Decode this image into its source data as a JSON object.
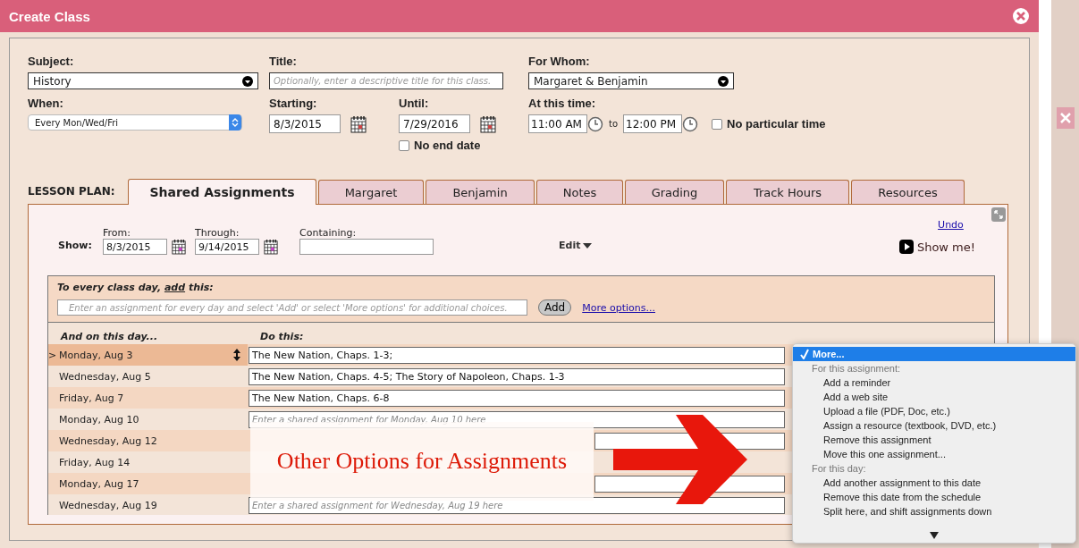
{
  "window": {
    "title": "Create Class"
  },
  "form": {
    "subject": {
      "label": "Subject:",
      "value": "History"
    },
    "title": {
      "label": "Title:",
      "placeholder": "Optionally, enter a descriptive title for this class."
    },
    "for_whom": {
      "label": "For Whom:",
      "value": "Margaret & Benjamin"
    },
    "when": {
      "label": "When:",
      "value": "Every Mon/Wed/Fri"
    },
    "starting": {
      "label": "Starting:",
      "value": "8/3/2015"
    },
    "until": {
      "label": "Until:",
      "value": "7/29/2016"
    },
    "no_end_date": {
      "label": "No end date",
      "checked": false
    },
    "at_this_time": {
      "label": "At this time:",
      "start": "11:00 AM",
      "to": "to",
      "end": "12:00 PM"
    },
    "no_particular_time": {
      "label": "No particular time",
      "checked": false
    }
  },
  "lesson_plan": {
    "label": "LESSON PLAN:",
    "tabs": [
      {
        "label": "Shared Assignments",
        "selected": true
      },
      {
        "label": "Margaret",
        "selected": false
      },
      {
        "label": "Benjamin",
        "selected": false
      },
      {
        "label": "Notes",
        "selected": false
      },
      {
        "label": "Grading",
        "selected": false
      },
      {
        "label": "Track Hours",
        "selected": false
      },
      {
        "label": "Resources",
        "selected": false
      }
    ]
  },
  "filter": {
    "show": "Show:",
    "from": {
      "label": "From:",
      "value": "8/3/2015"
    },
    "through": {
      "label": "Through:",
      "value": "9/14/2015"
    },
    "containing": {
      "label": "Containing:"
    },
    "edit": "Edit",
    "undo": "Undo",
    "show_me": "Show me!"
  },
  "every_day": {
    "heading_start": "To every class day,",
    "heading_link": "add",
    "heading_end": "this:",
    "placeholder": "Enter an assignment for every day and select 'Add' or select 'More options' for additional choices.",
    "add_button": "Add",
    "more_options": "More options..."
  },
  "schedule": {
    "columns": [
      "And on this day...",
      "Do this:"
    ],
    "current_marker": ">",
    "rows": [
      {
        "day": "Monday, Aug 3",
        "assignment": "The New Nation, Chaps. 1-3;",
        "selected": true
      },
      {
        "day": "Wednesday, Aug 5",
        "assignment": "The New Nation, Chaps. 4-5; The Story of Napoleon, Chaps. 1-3",
        "selected": false
      },
      {
        "day": "Friday, Aug 7",
        "assignment": "The New Nation, Chaps. 6-8",
        "selected": false
      },
      {
        "day": "Monday, Aug 10",
        "placeholder": "Enter a shared assignment for Monday, Aug 10 here",
        "selected": false
      },
      {
        "day": "Wednesday, Aug 12",
        "selected": false
      },
      {
        "day": "Friday, Aug 14",
        "selected": false
      },
      {
        "day": "Monday, Aug 17",
        "selected": false
      },
      {
        "day": "Wednesday, Aug 19",
        "placeholder": "Enter a shared assignment for Wednesday, Aug 19 here",
        "selected": false
      }
    ]
  },
  "menu": {
    "items": [
      {
        "kind": "option",
        "label": "More...",
        "selected": true
      },
      {
        "kind": "header",
        "label": "For this assignment:"
      },
      {
        "kind": "option",
        "label": "Add a reminder",
        "selected": false
      },
      {
        "kind": "option",
        "label": "Add a web site",
        "selected": false
      },
      {
        "kind": "option",
        "label": "Upload a file (PDF, Doc, etc.)",
        "selected": false
      },
      {
        "kind": "option",
        "label": "Assign a resource (textbook, DVD, etc.)",
        "selected": false
      },
      {
        "kind": "option",
        "label": "Remove this assignment",
        "selected": false
      },
      {
        "kind": "option",
        "label": "Move this one assignment...",
        "selected": false
      },
      {
        "kind": "header",
        "label": "For this day:"
      },
      {
        "kind": "option",
        "label": "Add another assignment to this date",
        "selected": false
      },
      {
        "kind": "option",
        "label": "Remove this date from the schedule",
        "selected": false
      },
      {
        "kind": "option",
        "label": "Split here, and shift assignments down",
        "selected": false
      }
    ]
  },
  "annotation": {
    "text": "Other Options for Assignments"
  }
}
